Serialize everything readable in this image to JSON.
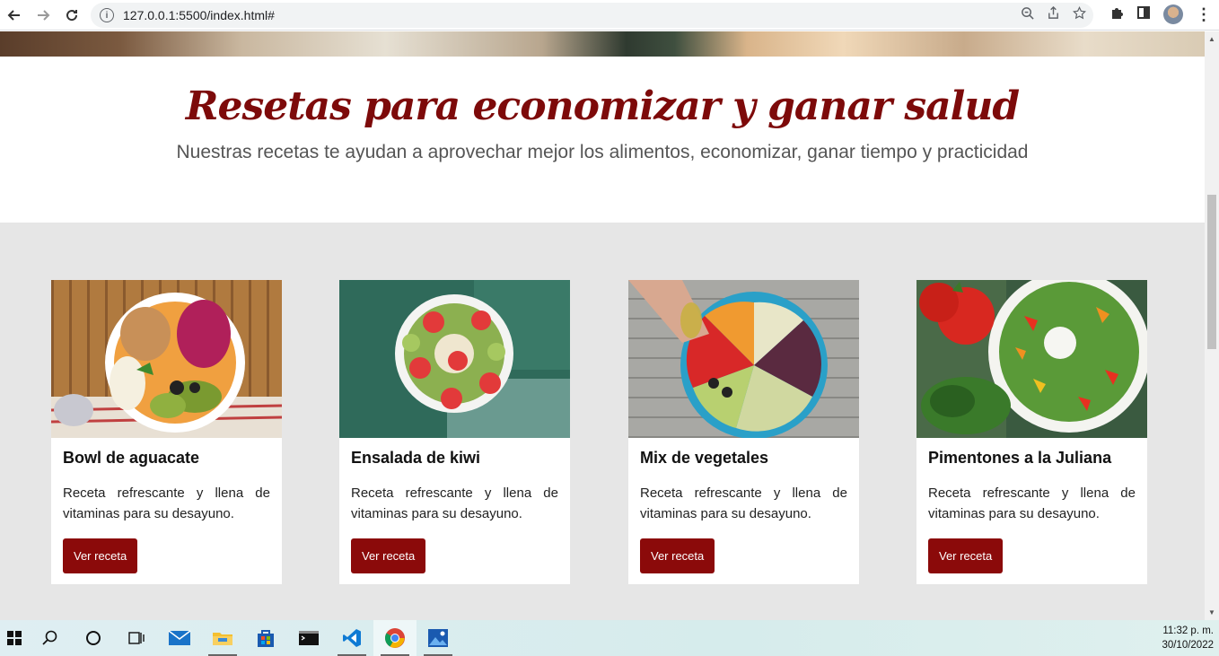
{
  "browser": {
    "url": "127.0.0.1:5500/index.html#"
  },
  "page": {
    "title": "Resetas para economizar y ganar salud",
    "subtitle": "Nuestras recetas te ayudan a aprovechar mejor los alimentos, economizar, ganar tiempo y practicidad",
    "cards": [
      {
        "title": "Bowl de aguacate",
        "text": "Receta refrescante y llena de vitaminas para su desayuno.",
        "button": "Ver receta"
      },
      {
        "title": "Ensalada de kiwi",
        "text": "Receta refrescante y llena de vitaminas para su desayuno.",
        "button": "Ver receta"
      },
      {
        "title": "Mix de vegetales",
        "text": "Receta refrescante y llena de vitaminas para su desayuno.",
        "button": "Ver receta"
      },
      {
        "title": "Pimentones a la Juliana",
        "text": "Receta refrescante y llena de vitaminas para su desayuno.",
        "button": "Ver receta"
      }
    ]
  },
  "taskbar": {
    "time": "11:32 p. m.",
    "date": "30/10/2022"
  },
  "colors": {
    "accent": "#8b0a0a",
    "title": "#7d0a0a",
    "section_bg": "#e6e6e6"
  }
}
